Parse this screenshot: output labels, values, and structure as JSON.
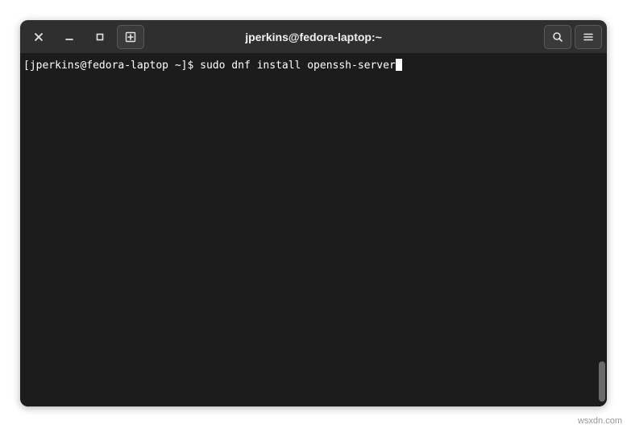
{
  "window": {
    "title": "jperkins@fedora-laptop:~"
  },
  "terminal": {
    "prompt": "[jperkins@fedora-laptop ~]$ ",
    "command": "sudo dnf install openssh-server"
  },
  "watermark": "wsxdn.com"
}
